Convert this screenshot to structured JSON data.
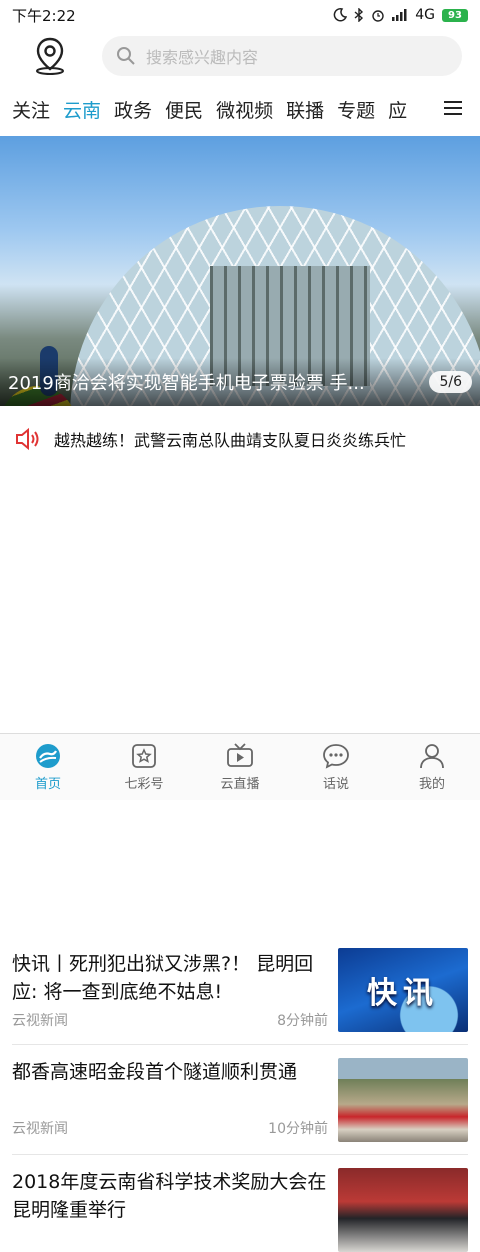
{
  "status_bar": {
    "time": "下午2:22",
    "network": "4G",
    "battery": "93"
  },
  "header": {
    "search_placeholder": "搜索感兴趣内容"
  },
  "tabs": [
    {
      "label": "关注",
      "active": false
    },
    {
      "label": "云南",
      "active": true
    },
    {
      "label": "政务",
      "active": false
    },
    {
      "label": "便民",
      "active": false
    },
    {
      "label": "微视频",
      "active": false
    },
    {
      "label": "联播",
      "active": false
    },
    {
      "label": "专题",
      "active": false
    },
    {
      "label": "应",
      "active": false
    }
  ],
  "banner": {
    "caption": "2019商洽会将实现智能手机电子票验票 手...",
    "pager": "5/6"
  },
  "ticker": {
    "text": "越热越练！武警云南总队曲靖支队夏日炎炎练兵忙"
  },
  "news": [
    {
      "title": "快讯丨死刑犯出狱又涉黑?！ 昆明回应: 将一查到底绝不姑息!",
      "source": "云视新闻",
      "time": "8分钟前",
      "thumb_text": "快讯"
    },
    {
      "title": "都香高速昭金段首个隧道顺利贯通",
      "source": "云视新闻",
      "time": "10分钟前",
      "thumb_text": ""
    },
    {
      "title": "2018年度云南省科学技术奖励大会在昆明隆重举行",
      "source": "",
      "time": "",
      "thumb_text": ""
    }
  ],
  "bottom_nav": [
    {
      "label": "首页",
      "icon": "home-icon",
      "active": true
    },
    {
      "label": "七彩号",
      "icon": "star-icon",
      "active": false
    },
    {
      "label": "云直播",
      "icon": "tv-icon",
      "active": false
    },
    {
      "label": "话说",
      "icon": "chat-icon",
      "active": false
    },
    {
      "label": "我的",
      "icon": "user-icon",
      "active": false
    }
  ],
  "colors": {
    "accent": "#1e9ccc",
    "ticker_icon": "#e03434"
  }
}
